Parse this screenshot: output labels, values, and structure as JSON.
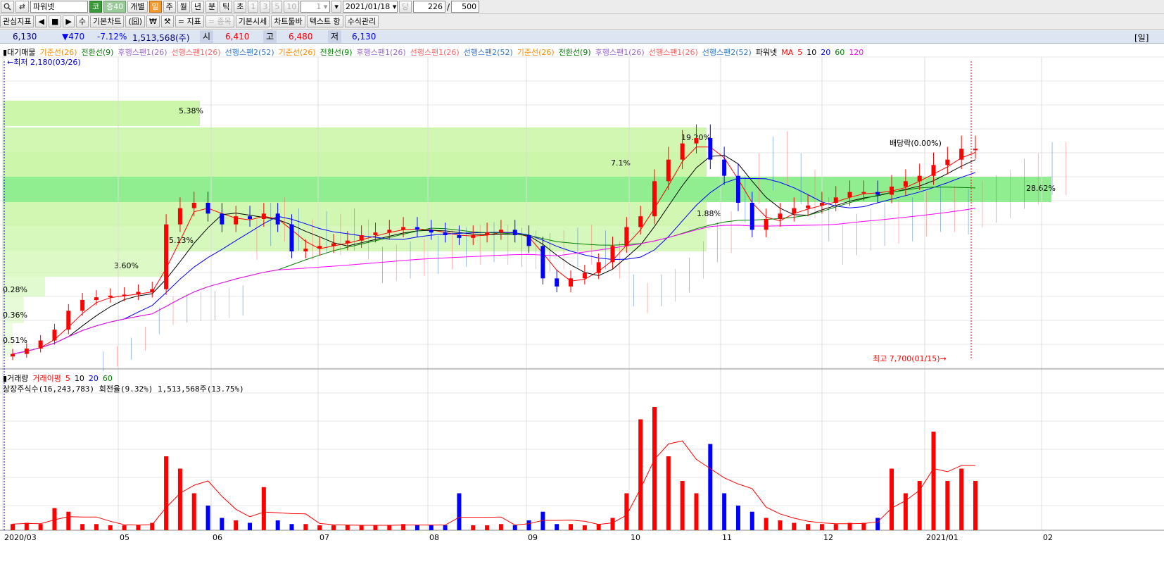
{
  "toolbar1": {
    "search_icon": "search-icon",
    "refresh_icon": "refresh-icon",
    "stock_name": "파워넷",
    "market_badge": "코",
    "credit_badge": "증40",
    "mode_label": "개별",
    "periods": [
      "일",
      "주",
      "월",
      "년",
      "분",
      "틱",
      "초"
    ],
    "active_period": "일",
    "intervals": [
      "1",
      "3",
      "5",
      "10"
    ],
    "interval_value": "1",
    "date": "2021/01/18",
    "date_suffix": "당",
    "count_shown": "226",
    "count_sep": "/",
    "count_total": "500"
  },
  "toolbar2": {
    "buttons": [
      "관심지표",
      "◀",
      "■",
      "▶",
      "수",
      "기본차트",
      "(囧)",
      "₩",
      "⚒",
      "= 지표",
      "= 종목",
      "기본시세",
      "차트툴바",
      "텍스트 항",
      "수식관리"
    ]
  },
  "pricebar": {
    "price": "6,130",
    "change": "▼470",
    "change_pct": "-7.12%",
    "volume": "1,513,568(주)",
    "open_label": "시",
    "open": "6,410",
    "high_label": "고",
    "high": "6,480",
    "low_label": "저",
    "low": "6,130",
    "period_tag": "[일]",
    "colors": {
      "down": "#0000ff",
      "text": "#000080"
    }
  },
  "price_legend": [
    {
      "text": "대기매물",
      "color": "#000000"
    },
    {
      "text": "기준선(26)",
      "color": "#ff8c00"
    },
    {
      "text": "전환선(9)",
      "color": "#008000"
    },
    {
      "text": "후행스팬1(26)",
      "color": "#9966cc"
    },
    {
      "text": "선행스팬1(26)",
      "color": "#ff6666"
    },
    {
      "text": "선행스팬2(52)",
      "color": "#3377cc"
    },
    {
      "text": "기준선(26)",
      "color": "#ff8c00"
    },
    {
      "text": "전환선(9)",
      "color": "#008000"
    },
    {
      "text": "후행스팬1(26)",
      "color": "#9966cc"
    },
    {
      "text": "선행스팬1(26)",
      "color": "#ff6666"
    },
    {
      "text": "선행스팬2(52)",
      "color": "#3377cc"
    },
    {
      "text": "기준선(26)",
      "color": "#ff8c00"
    },
    {
      "text": "전환선(9)",
      "color": "#008000"
    },
    {
      "text": "후행스팬1(26)",
      "color": "#9966cc"
    },
    {
      "text": "선행스팬1(26)",
      "color": "#ff6666"
    },
    {
      "text": "선행스팬2(52)",
      "color": "#3377cc"
    },
    {
      "text": "파워넷",
      "color": "#000000"
    },
    {
      "text": "MA",
      "color": "#ff0000"
    },
    {
      "text": "5",
      "color": "#ff0000"
    },
    {
      "text": "10",
      "color": "#000000"
    },
    {
      "text": "20",
      "color": "#0000ff"
    },
    {
      "text": "60",
      "color": "#008000"
    },
    {
      "text": "120",
      "color": "#ff00ff"
    }
  ],
  "volume_legend": [
    {
      "text": "거래량",
      "color": "#000000"
    },
    {
      "text": "거래이평",
      "color": "#ff0000"
    },
    {
      "text": "5",
      "color": "#ff0000"
    },
    {
      "text": "10",
      "color": "#000000"
    },
    {
      "text": "20",
      "color": "#0000ff"
    },
    {
      "text": "60",
      "color": "#008000"
    }
  ],
  "volume_info": "상장주식수(16,243,783) 회전율(9.32%) 1,513,568주(13.75%)",
  "chart_data": {
    "type": "candlestick",
    "low_marker": "최저 2,180(03/26)",
    "high_marker": "최고 7,700(01/15)",
    "dividend_marker": "배당락(0.00%)",
    "x_ticks": [
      "2020/03",
      "05",
      "06",
      "07",
      "08",
      "09",
      "10",
      "11",
      "12",
      "2021/01",
      "02"
    ],
    "supply_zones_pct": [
      "5.38%",
      "19.20%",
      "28.62%",
      "5.13%",
      "3.60%",
      "0.28%",
      "0.36%",
      "0.51%",
      "1.88%",
      "7.1%"
    ],
    "colors": {
      "up": "#ff0000",
      "down": "#0000ff",
      "zone": "#c6f5a0",
      "zone_strong": "#90ee90",
      "cloud_up": "#ff6666",
      "cloud_down": "#3377cc"
    },
    "y_range": [
      2100,
      7800
    ],
    "closes": [
      2300,
      2400,
      2550,
      2750,
      3100,
      3300,
      3350,
      3380,
      3400,
      3450,
      3500,
      4700,
      5000,
      5100,
      4900,
      4700,
      4850,
      4800,
      4900,
      4700,
      4200,
      4250,
      4300,
      4350,
      4400,
      4500,
      4550,
      4600,
      4650,
      4600,
      4550,
      4500,
      4450,
      4500,
      4550,
      4600,
      4500,
      4300,
      3700,
      3550,
      3700,
      3800,
      4000,
      4300,
      4650,
      4850,
      5500,
      5900,
      6200,
      6300,
      5900,
      5600,
      5100,
      4600,
      4800,
      4900,
      5000,
      5050,
      5100,
      5200,
      5300,
      5300,
      5250,
      5400,
      5500,
      5600,
      5800,
      5900,
      6100,
      6100
    ],
    "volumes": [
      0.05,
      0.06,
      0.05,
      0.18,
      0.15,
      0.05,
      0.05,
      0.04,
      0.04,
      0.04,
      0.06,
      0.6,
      0.5,
      0.3,
      0.2,
      0.1,
      0.08,
      0.06,
      0.35,
      0.08,
      0.05,
      0.05,
      0.04,
      0.04,
      0.04,
      0.04,
      0.04,
      0.04,
      0.05,
      0.04,
      0.04,
      0.04,
      0.3,
      0.04,
      0.04,
      0.05,
      0.04,
      0.08,
      0.15,
      0.05,
      0.05,
      0.04,
      0.05,
      0.1,
      0.3,
      0.9,
      1.0,
      0.6,
      0.4,
      0.3,
      0.7,
      0.3,
      0.2,
      0.15,
      0.1,
      0.08,
      0.06,
      0.05,
      0.05,
      0.05,
      0.06,
      0.06,
      0.1,
      0.5,
      0.3,
      0.4,
      0.8,
      0.4,
      0.5,
      0.4
    ]
  }
}
